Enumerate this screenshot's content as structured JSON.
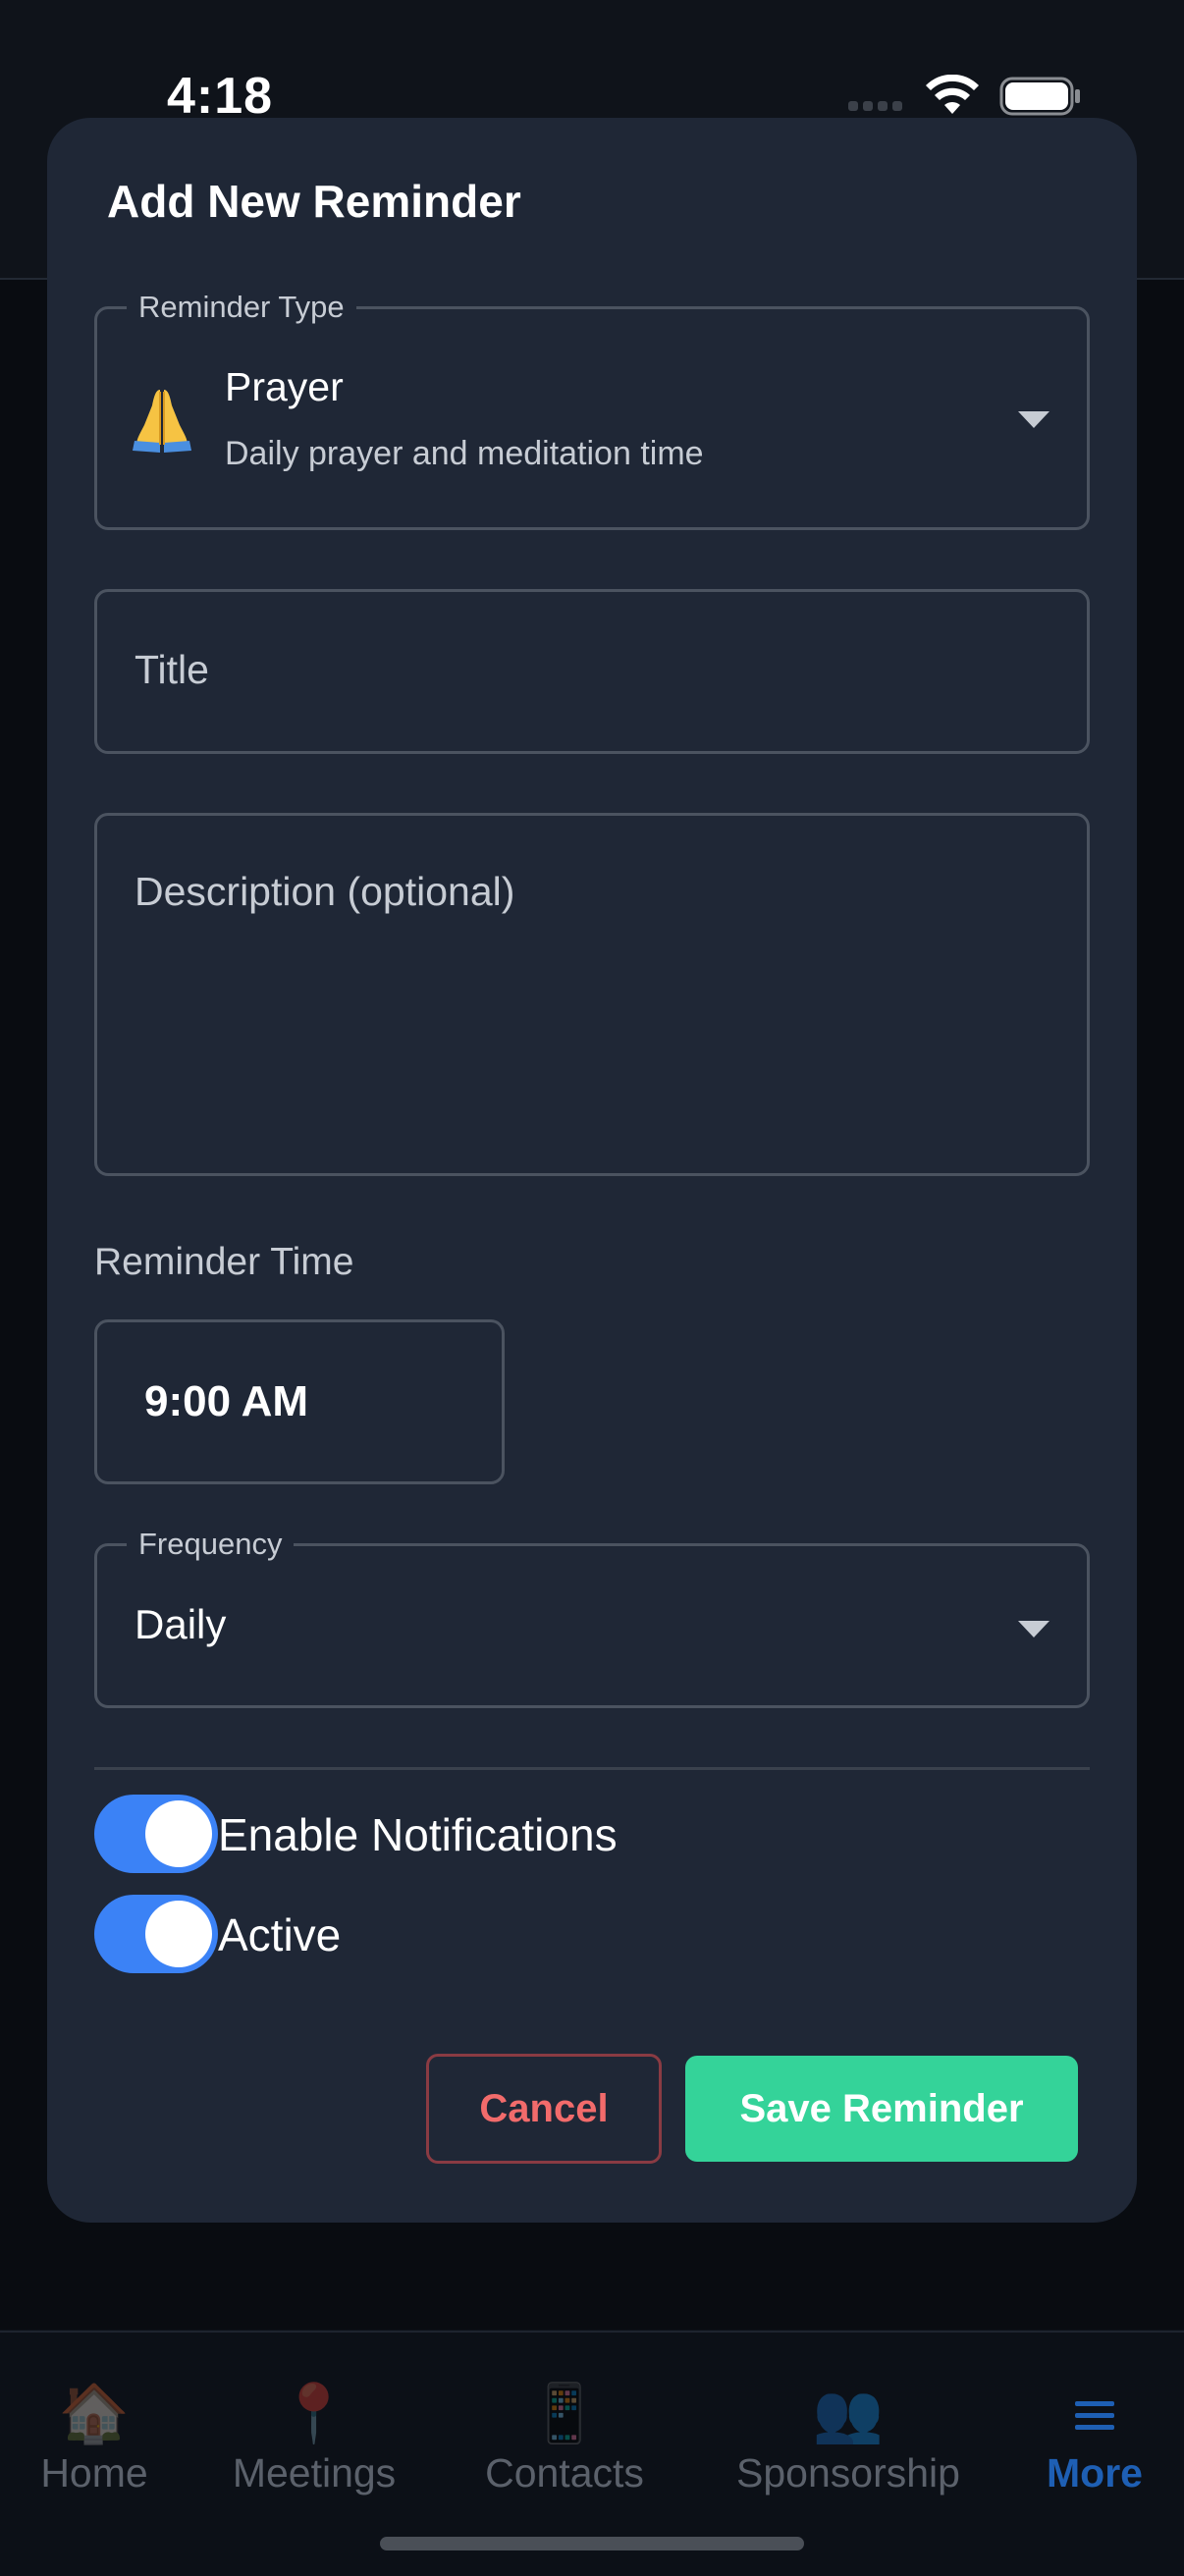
{
  "status_bar": {
    "time": "4:18"
  },
  "modal": {
    "title": "Add New Reminder",
    "reminder_type": {
      "label": "Reminder Type",
      "emoji": "🙏",
      "name": "Prayer",
      "description": "Daily prayer and meditation time"
    },
    "title_field": {
      "placeholder": "Title",
      "value": ""
    },
    "description_field": {
      "placeholder": "Description (optional)",
      "value": ""
    },
    "reminder_time": {
      "label": "Reminder Time",
      "value": "9:00 AM"
    },
    "frequency": {
      "label": "Frequency",
      "value": "Daily"
    },
    "toggles": {
      "notifications": {
        "label": "Enable Notifications",
        "on": true
      },
      "active": {
        "label": "Active",
        "on": true
      }
    },
    "buttons": {
      "cancel": "Cancel",
      "save": "Save Reminder"
    }
  },
  "tab_bar": {
    "items": [
      {
        "label": "Home",
        "icon": "house-icon",
        "glyph": "🏠",
        "active": false
      },
      {
        "label": "Meetings",
        "icon": "pin-icon",
        "glyph": "📍",
        "active": false
      },
      {
        "label": "Contacts",
        "icon": "phone-icon",
        "glyph": "📱",
        "active": false
      },
      {
        "label": "Sponsorship",
        "icon": "people-icon",
        "glyph": "👥",
        "active": false
      },
      {
        "label": "More",
        "icon": "menu-icon",
        "glyph": "",
        "active": true
      }
    ]
  },
  "colors": {
    "accent_blue": "#3b82f6",
    "save_green": "#34d399",
    "cancel_red": "#f26b6b",
    "modal_bg": "#1f2736",
    "active_tab": "#1e5fb4"
  }
}
